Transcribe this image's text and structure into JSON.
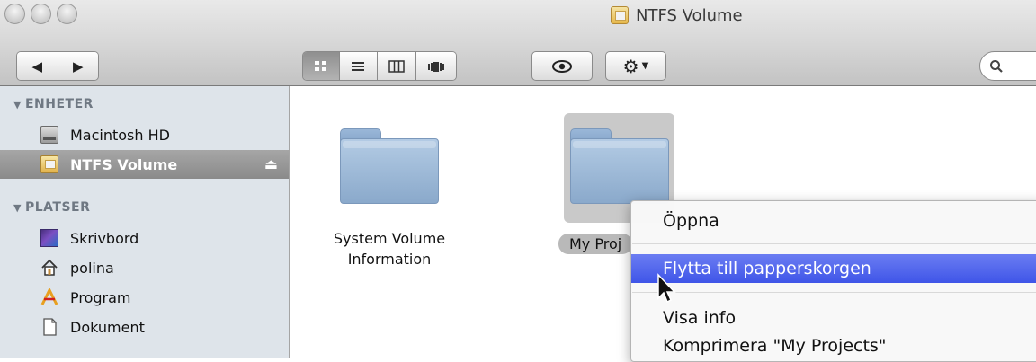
{
  "window": {
    "title": "NTFS Volume"
  },
  "toolbar": {
    "back_icon": "back-arrow-icon",
    "forward_icon": "forward-arrow-icon",
    "view_modes": [
      "icon-view",
      "list-view",
      "column-view",
      "coverflow-view"
    ],
    "active_view": "icon-view",
    "quicklook_icon": "eye-icon",
    "action_icon": "gear-icon",
    "search_icon": "search-icon"
  },
  "sidebar": {
    "sections": [
      {
        "label": "ENHETER",
        "items": [
          {
            "label": "Macintosh HD",
            "icon": "hard-drive-icon"
          },
          {
            "label": "NTFS Volume",
            "icon": "ntfs-drive-icon",
            "selected": true,
            "eject": "eject-icon"
          }
        ]
      },
      {
        "label": "PLATSER",
        "items": [
          {
            "label": "Skrivbord",
            "icon": "desktop-icon"
          },
          {
            "label": "polina",
            "icon": "home-icon"
          },
          {
            "label": "Program",
            "icon": "applications-icon"
          },
          {
            "label": "Dokument",
            "icon": "documents-icon"
          }
        ]
      }
    ]
  },
  "content": {
    "items": [
      {
        "label_line1": "System Volume",
        "label_line2": "Information",
        "icon": "folder-icon"
      },
      {
        "label": "My Proj",
        "icon": "folder-icon",
        "selected": true
      }
    ]
  },
  "context_menu": {
    "items": [
      "Öppna",
      "Flytta till papperskorgen",
      "Visa info",
      "Komprimera \"My Projects\""
    ],
    "highlighted_index": 1
  },
  "colors": {
    "menu_highlight": "#3f55e8",
    "sidebar_bg": "#dee4ea",
    "folder_blue": "#9ab7d8"
  }
}
